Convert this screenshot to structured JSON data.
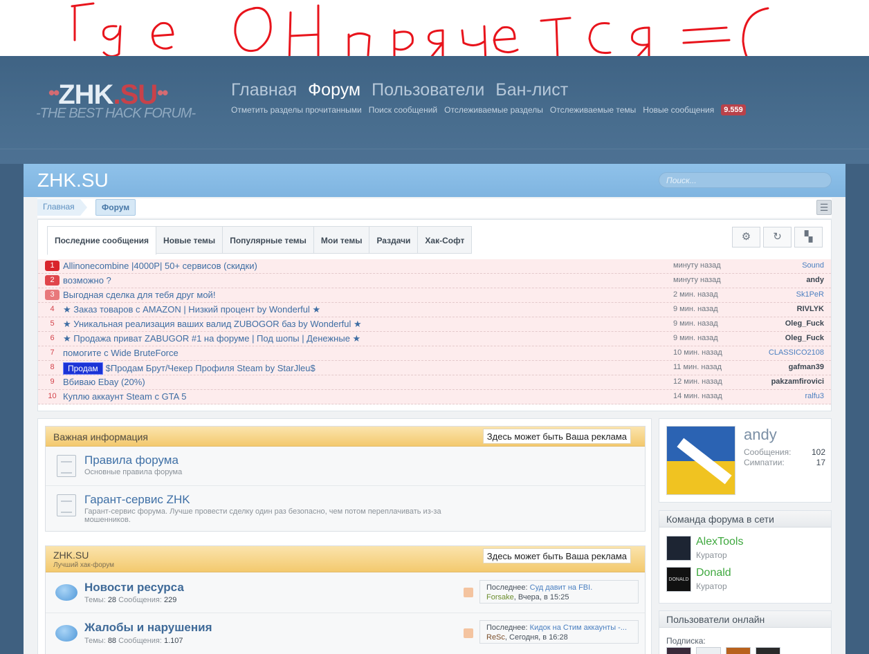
{
  "annotation": {
    "text": "Где ОН прячется =С"
  },
  "logo": {
    "main_prefix": "ZHK",
    "main_suffix": ".SU",
    "tagline": "-THE BEST HACK FORUM-"
  },
  "nav": {
    "items": [
      "Главная",
      "Форум",
      "Пользователи",
      "Бан-лист"
    ],
    "active": "Форум"
  },
  "subnav": {
    "items": [
      "Отметить разделы прочитанными",
      "Поиск сообщений",
      "Отслеживаемые разделы",
      "Отслеживаемые темы",
      "Новые сообщения"
    ],
    "new_count": "9.559"
  },
  "site": {
    "title": "ZHK.SU",
    "search_placeholder": "Поиск..."
  },
  "breadcrumb": {
    "home": "Главная",
    "current": "Форум"
  },
  "tabs": [
    "Последние сообщения",
    "Новые темы",
    "Популярные темы",
    "Мои темы",
    "Раздачи",
    "Хак-Софт"
  ],
  "recent": [
    {
      "n": "1",
      "title": "Allinonecombine |4000P| 50+ сервисов (скидки)",
      "time": "минуту назад",
      "user": "Sound"
    },
    {
      "n": "2",
      "title": "возможно ?",
      "time": "минуту назад",
      "user": "andy"
    },
    {
      "n": "3",
      "title": "Выгодная сделка для тебя друг мой!",
      "time": "2 мин. назад",
      "user": "Sk1PeR"
    },
    {
      "n": "4",
      "title": "★ Заказ товаров с AMAZON | Низкий процент by Wonderful ★",
      "time": "9 мин. назад",
      "user": "RIVLYK"
    },
    {
      "n": "5",
      "title": "★ Уникальная реализация ваших валид ZUBOGOR баз by Wonderful ★",
      "time": "9 мин. назад",
      "user": "Oleg_Fuck"
    },
    {
      "n": "6",
      "title": "★ Продажа приват ZABUGOR #1 на форуме | Под шопы | Денежные ★",
      "time": "9 мин. назад",
      "user": "Oleg_Fuck"
    },
    {
      "n": "7",
      "title": "помогите с Wide BruteForce",
      "time": "10 мин. назад",
      "user": "CLASSICO2108"
    },
    {
      "n": "8",
      "prefix": "Продам",
      "title": "$Продам Брут/Чекер Профиля Steam by StarJleu$",
      "time": "11 мин. назад",
      "user": "gafman39"
    },
    {
      "n": "9",
      "title": "Вбиваю Ebay (20%)",
      "time": "12 мин. назад",
      "user": "pakzamfirovici"
    },
    {
      "n": "10",
      "title": "Куплю аккаунт Steam с GTA 5",
      "time": "14 мин. назад",
      "user": "ralfu3"
    }
  ],
  "important": {
    "title": "Важная информация",
    "ad": "Здесь может быть Ваша реклама",
    "items": [
      {
        "title": "Правила форума",
        "desc": "Основные правила форума"
      },
      {
        "title": "Гарант-сервис ZHK",
        "desc": "Гарант-сервис форума. Лучше провести сделку один раз безопасно, чем потом переплачивать из-за мошенников."
      }
    ]
  },
  "category": {
    "title": "ZHK.SU",
    "desc": "Лучший хак-форум",
    "ad": "Здесь может быть Ваша реклама",
    "forums": [
      {
        "title": "Новости ресурса",
        "threads_label": "Темы:",
        "threads": "28",
        "posts_label": "Сообщения:",
        "posts": "229",
        "last_label": "Последнее:",
        "last_title": "Суд давит на FBI.",
        "last_user": "Forsake",
        "last_time": ", Вчера, в 15:25"
      },
      {
        "title": "Жалобы и нарушения",
        "threads_label": "Темы:",
        "threads": "88",
        "posts_label": "Сообщения:",
        "posts": "1.107",
        "last_label": "Последнее:",
        "last_title": "Кидок на Стим аккаунты -...",
        "last_user": "ReSc",
        "last_time": ", Сегодня, в 16:28"
      }
    ]
  },
  "profile": {
    "name": "andy",
    "posts_label": "Сообщения:",
    "posts": "102",
    "likes_label": "Симпатии:",
    "likes": "17"
  },
  "staff_online": {
    "title": "Команда форума в сети",
    "members": [
      {
        "name": "AlexTools",
        "role": "Куратор"
      },
      {
        "name": "Donald",
        "role": "Куратор",
        "avatar_text": "DONALD"
      }
    ]
  },
  "users_online": {
    "title": "Пользователи онлайн",
    "subscription_label": "Подписка:"
  }
}
